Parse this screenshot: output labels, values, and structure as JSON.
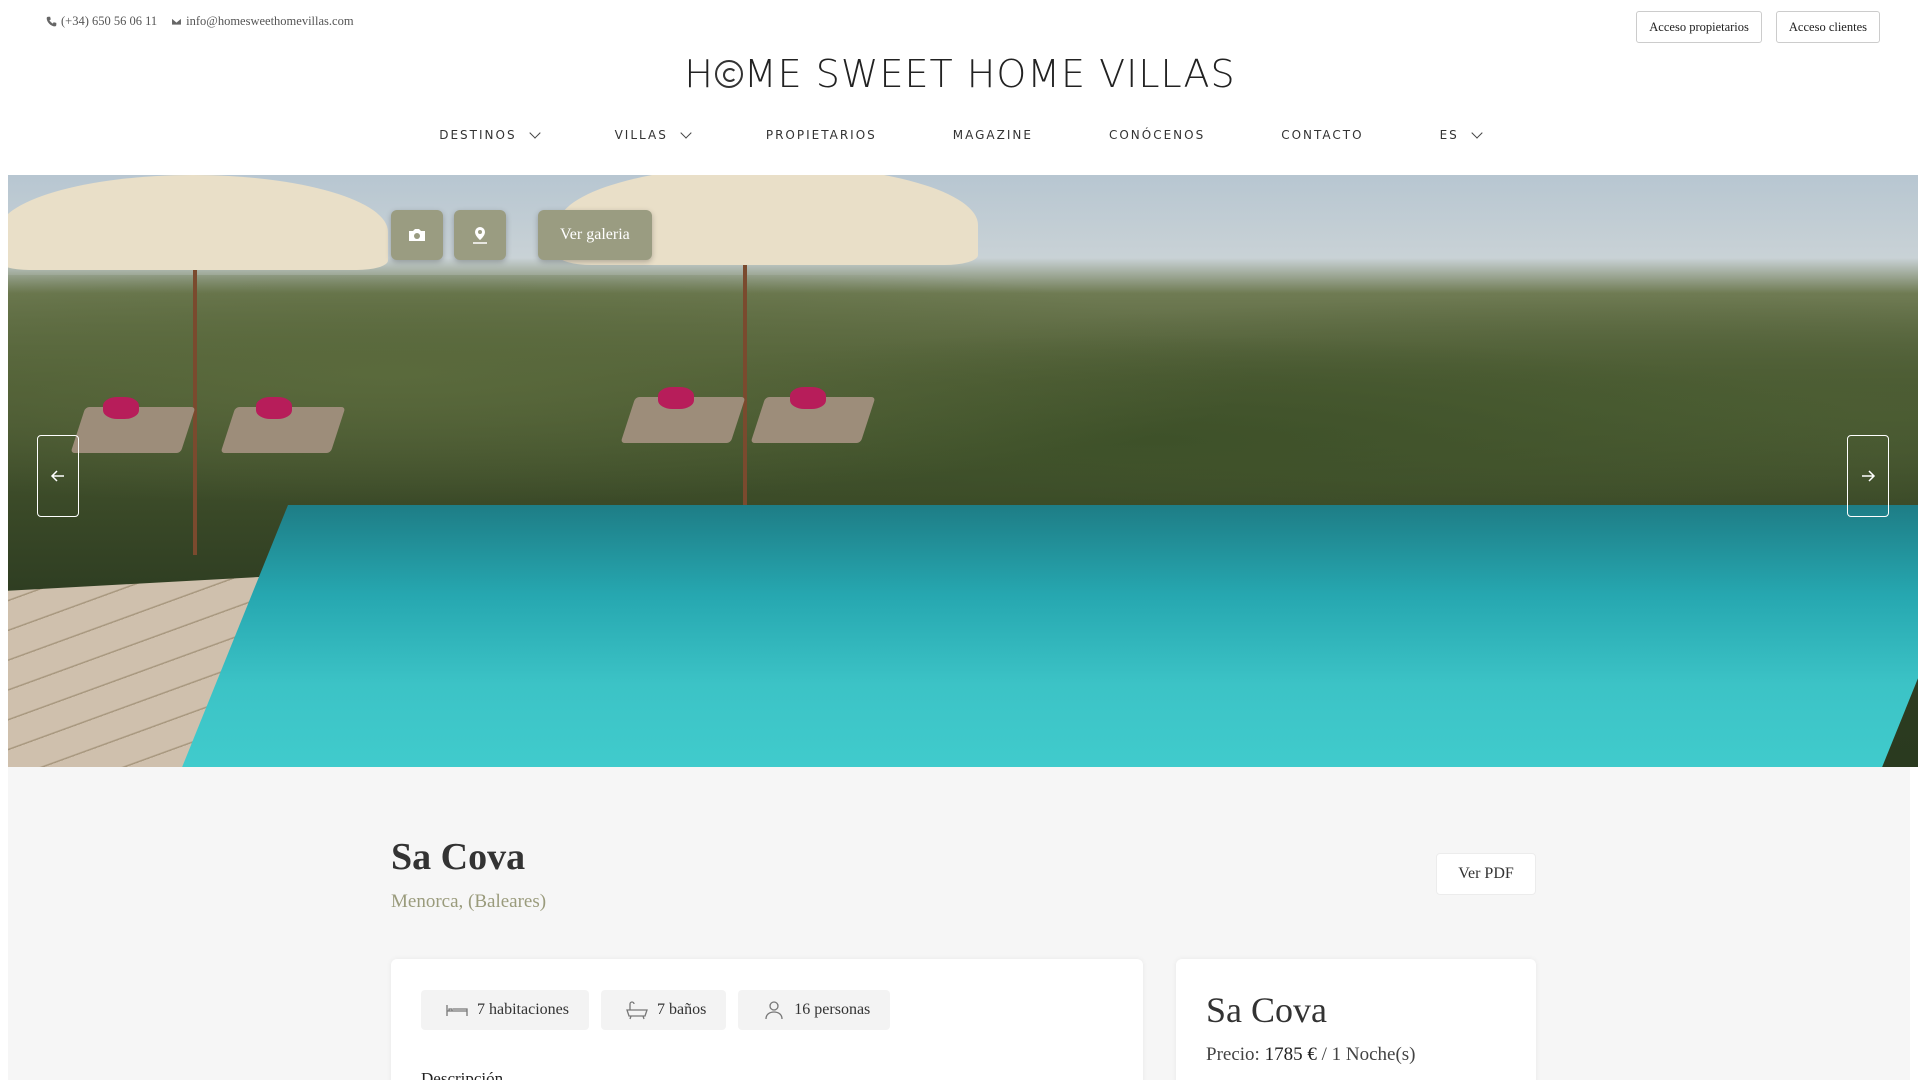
{
  "topbar": {
    "phone": "(+34) 650 56 06 11",
    "email": "info@homesweethomevillas.com",
    "owners_access": "Acceso propietarios",
    "clients_access": "Acceso clientes"
  },
  "logo": {
    "part1": "H",
    "part2": "ME SWEET HOME VILLAS"
  },
  "nav": {
    "items": [
      {
        "label": "DESTINOS",
        "dropdown": true
      },
      {
        "label": "VILLAS",
        "dropdown": true
      },
      {
        "label": "PROPIETARIOS",
        "dropdown": false
      },
      {
        "label": "MAGAZINE",
        "dropdown": false
      },
      {
        "label": "CONÓCENOS",
        "dropdown": false
      },
      {
        "label": "CONTACTO",
        "dropdown": false
      },
      {
        "label": "ES",
        "dropdown": true
      }
    ]
  },
  "hero": {
    "gallery_button": "Ver galeria",
    "camera_icon": "camera-icon",
    "map_icon": "map-pin-icon"
  },
  "property": {
    "title": "Sa Cova",
    "location": "Menorca, (Baleares)",
    "pdf_button": "Ver PDF",
    "bedrooms": "7 habitaciones",
    "bathrooms": "7 baños",
    "guests": "16 personas",
    "description_heading": "Descripción"
  },
  "booking": {
    "title": "Sa Cova",
    "price_label": "Precio:",
    "price_value": "1785 €",
    "price_unit": "/ 1 Noche(s)"
  },
  "colors": {
    "accent": "#9a9c81",
    "location_text": "#9a9b7c",
    "background": "#f6f6f6"
  }
}
